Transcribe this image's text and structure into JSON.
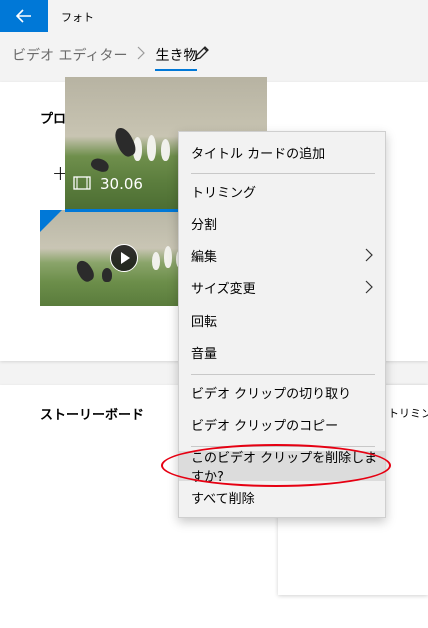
{
  "app": {
    "title": "フォト"
  },
  "breadcrumb": {
    "root": "ビデオ エディター",
    "current": "生き物"
  },
  "library": {
    "title": "プロジェクト ライブラリ",
    "add_label": "追加"
  },
  "storyboard": {
    "title": "ストーリーボード",
    "trim_label": "トリミング",
    "clip_duration": "30.06"
  },
  "context_menu": {
    "items": [
      "タイトル カードの追加",
      "トリミング",
      "分割",
      "編集",
      "サイズ変更",
      "回転",
      "音量",
      "ビデオ クリップの切り取り",
      "ビデオ クリップのコピー",
      "このビデオ クリップを削除しますか?",
      "すべて削除"
    ]
  },
  "colors": {
    "accent": "#0078d7",
    "annotation": "#e60012"
  },
  "icons": [
    "back-arrow-icon",
    "pencil-icon",
    "plus-icon",
    "play-icon",
    "film-icon",
    "volume-icon",
    "chevron-right-icon"
  ]
}
